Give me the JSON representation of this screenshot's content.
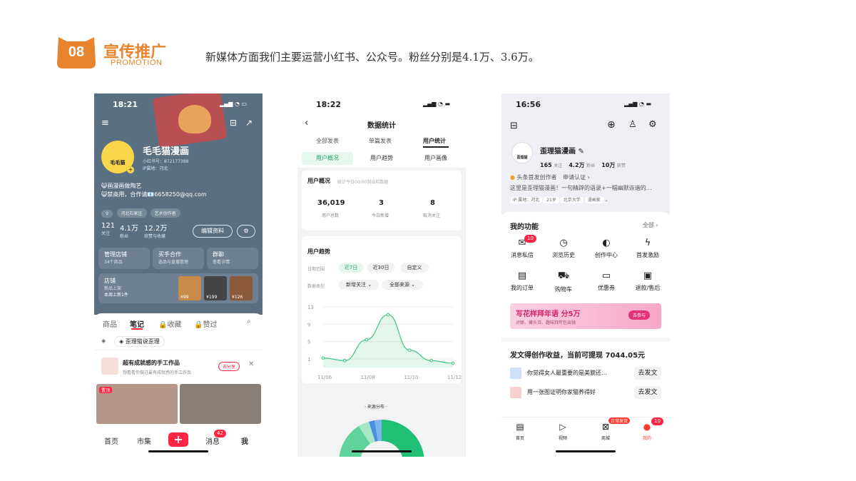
{
  "slide": {
    "number": "08",
    "title_cn": "宣传推广",
    "title_en": "PROMOTION",
    "headline": "新媒体方面我们主要运营小红书、公众号。粉丝分别是4.1万、3.6万。",
    "accent_color": "#e8842e"
  },
  "phone1": {
    "time": "18:21",
    "profile_name": "毛毛猫漫画",
    "avatar_text": "毛毛猫",
    "xhs_id": "小红书号：872177388",
    "ip": "IP属地：河北",
    "bio1": "😺画漫画做陶艺",
    "bio2": "😺禁商用，合作请📧6658250@qq.com",
    "tags": [
      "河北石家庄",
      "艺术创作者"
    ],
    "stats": [
      {
        "value": "121",
        "label": "关注"
      },
      {
        "value": "4.1万",
        "label": "粉丝"
      },
      {
        "value": "12.2万",
        "label": "获赞与收藏"
      }
    ],
    "edit_button": "编辑资料",
    "cards": [
      {
        "title": "管理店铺",
        "sub": "34个商品"
      },
      {
        "title": "买手合作",
        "sub": "选品与直播管理"
      },
      {
        "title": "群聊",
        "sub": "查看详情"
      }
    ],
    "shop": {
      "title": "店铺",
      "sub1": "新品上架",
      "sub2": "本周上新1件",
      "prices": [
        "¥99",
        "¥199",
        "¥126"
      ]
    },
    "tabs": [
      "商品",
      "笔记",
      "收藏",
      "赞过"
    ],
    "active_tab": "笔记",
    "collection": "歪理猫说歪理",
    "promo_title": "超有成就感的手工作品",
    "promo_sub": "想看看你做过最有成就感的手工作品",
    "promo_btn": "去分享",
    "note_tag": "置顶",
    "nav": [
      "首页",
      "市集",
      "+",
      "消息",
      "我"
    ],
    "msg_badge": "42"
  },
  "phone2": {
    "time": "18:22",
    "page_title": "数据统计",
    "top_tabs": [
      "全部发表",
      "单篇发表",
      "用户统计"
    ],
    "active_top_tab": "用户统计",
    "sub_tabs": [
      "用户概况",
      "用户趋势",
      "用户画像"
    ],
    "active_sub_tab": "用户概况",
    "overview_title": "用户概况",
    "overview_note": "统计今日00:00到当前数据",
    "overview_stats": [
      {
        "value": "36,019",
        "label": "用户总数"
      },
      {
        "value": "3",
        "label": "今日新增"
      },
      {
        "value": "8",
        "label": "取消关注"
      }
    ],
    "trend_title": "用户趋势",
    "date_label": "日期范围",
    "date_pills": [
      "近7日",
      "近30日",
      "自定义"
    ],
    "type_label": "数据类型",
    "type_pills": [
      "新增关注 ⌄",
      "全部来源 ⌄"
    ],
    "source_title": "· 来源分布 ·"
  },
  "chart_data": {
    "type": "line",
    "x": [
      "11/06",
      "11/07",
      "11/08",
      "11/09",
      "11/10",
      "11/11",
      "11/12"
    ],
    "x_tick_labels": [
      "11/06",
      "11/08",
      "11/10",
      "11/12"
    ],
    "series": [
      {
        "values": [
          1.2,
          0.6,
          5.4,
          11.2,
          3.0,
          0.6,
          0.0
        ]
      }
    ],
    "y_ticks": [
      1,
      5,
      9,
      13
    ],
    "ylim": [
      -1,
      13.5
    ],
    "grid": true,
    "color": "#3ac47d"
  },
  "phone3": {
    "time": "16:56",
    "profile_name": "歪理猫漫画",
    "avatar_text": "歪理猫",
    "stats": [
      {
        "value": "165",
        "label": "关注"
      },
      {
        "value": "4.2万",
        "label": "粉丝"
      },
      {
        "value": "10万",
        "label": "获赞"
      }
    ],
    "creator_badge": "头条首发创作者",
    "apply_link": "申请认证 ›",
    "bio": "这里是歪理猫漫画！一句精辟的语录+一幅幽默诙谐的…",
    "tags": [
      "IP 属地：河北",
      "21岁",
      "北京大学",
      "漫画家"
    ],
    "functions_title": "我的功能",
    "functions_all": "全部 ›",
    "functions": [
      "消息私信",
      "浏览历史",
      "创作中心",
      "首发激励",
      "我的订单",
      "购物车",
      "优惠券",
      "退款/售后"
    ],
    "msg_badge": "10",
    "banner_title": "写花样拜年语 分5万",
    "banner_sub": "对联、藏头诗、趣味拜年包出镜",
    "banner_btn": "去参与",
    "income_text": "发文得创作收益，当前可提现 7044.05元",
    "posts": [
      {
        "text": "你觉得女人最重要的是美貌还…",
        "btn": "去发文"
      },
      {
        "text": "用一张图证明你家猫养得好",
        "btn": "去发文"
      }
    ],
    "nav": [
      "首页",
      "视频",
      "商城",
      "我的"
    ],
    "shop_badge": "正常发货",
    "me_badge": "10"
  }
}
